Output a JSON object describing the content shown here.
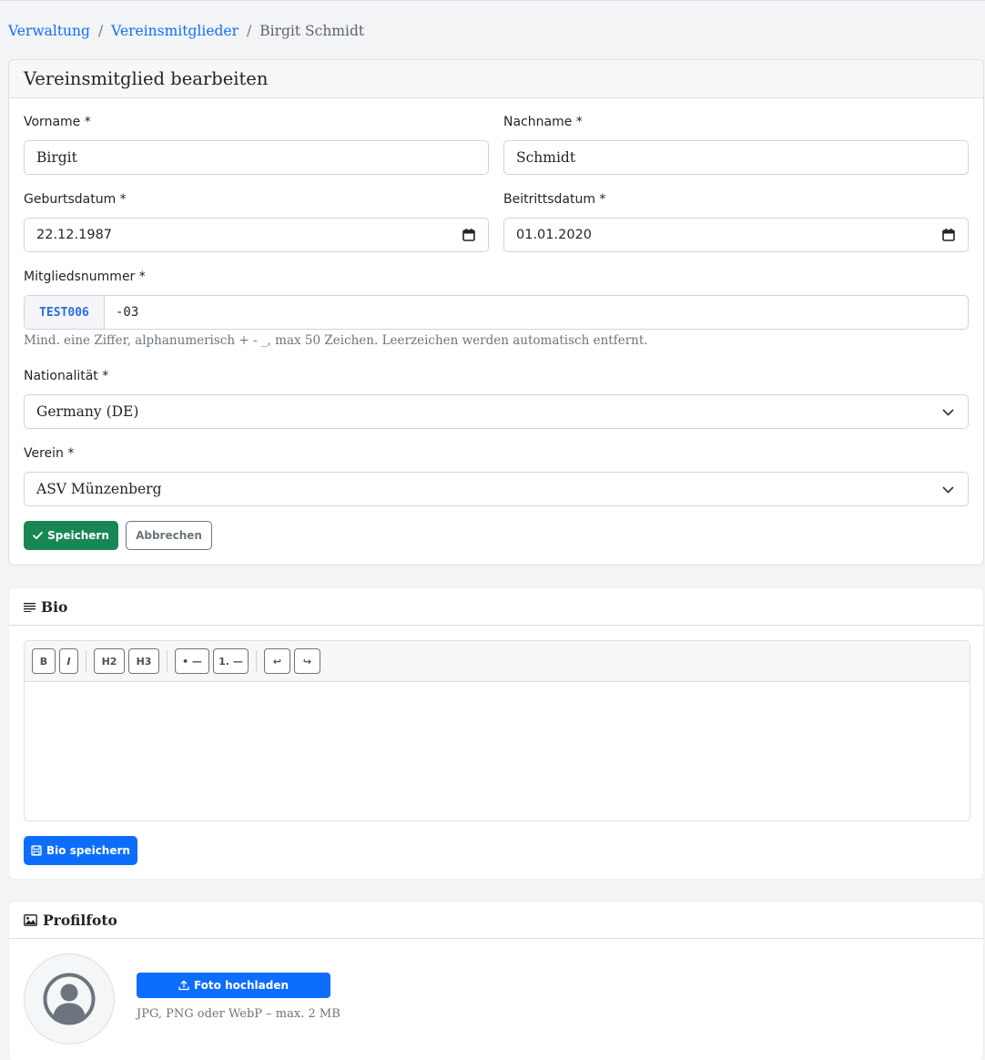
{
  "breadcrumb": {
    "items": [
      "Verwaltung",
      "Vereinsmitglieder"
    ],
    "current": "Birgit Schmidt",
    "separator": "/"
  },
  "edit_form": {
    "title": "Vereinsmitglied bearbeiten",
    "first_name": {
      "label": "Vorname *",
      "value": "Birgit"
    },
    "last_name": {
      "label": "Nachname *",
      "value": "Schmidt"
    },
    "birth_date": {
      "label": "Geburtsdatum *",
      "value": "22.12.1987"
    },
    "join_date": {
      "label": "Beitrittsdatum *",
      "value": "01.01.2020"
    },
    "member_number": {
      "label": "Mitgliedsnummer *",
      "prefix": "TEST006",
      "value": "-03",
      "hint": "Mind. eine Ziffer, alphanumerisch + - _, max 50 Zeichen. Leerzeichen werden automatisch entfernt."
    },
    "nationality": {
      "label": "Nationalität *",
      "value": "Germany (DE)"
    },
    "club": {
      "label": "Verein *",
      "value": "ASV Münzenberg"
    },
    "save_label": "Speichern",
    "cancel_label": "Abbrechen"
  },
  "bio": {
    "title": "Bio",
    "toolbar": [
      "B",
      "I",
      "H2",
      "H3",
      "• —",
      "1. —",
      "↩",
      "↪"
    ],
    "content": "",
    "save_label": "Bio speichern"
  },
  "photo": {
    "title": "Profilfoto",
    "upload_label": "Foto hochladen",
    "hint": "JPG, PNG oder WebP – max. 2 MB"
  },
  "colors": {
    "link": "#0d6efd",
    "success": "#198754",
    "primary": "#0d6efd",
    "secondary": "#6c757d"
  }
}
